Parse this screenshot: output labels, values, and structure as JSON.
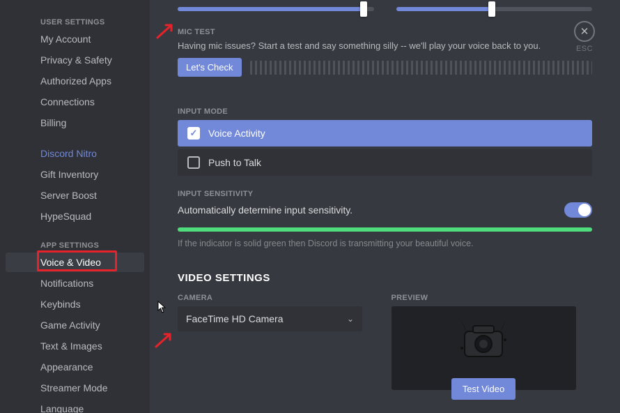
{
  "esc_label": "ESC",
  "sidebar": {
    "header1": "USER SETTINGS",
    "items1": [
      {
        "label": "My Account"
      },
      {
        "label": "Privacy & Safety"
      },
      {
        "label": "Authorized Apps"
      },
      {
        "label": "Connections"
      },
      {
        "label": "Billing"
      }
    ],
    "items2": [
      {
        "label": "Discord Nitro"
      },
      {
        "label": "Gift Inventory"
      },
      {
        "label": "Server Boost"
      },
      {
        "label": "HypeSquad"
      }
    ],
    "header2": "APP SETTINGS",
    "items3": [
      {
        "label": "Voice & Video"
      },
      {
        "label": "Notifications"
      },
      {
        "label": "Keybinds"
      },
      {
        "label": "Game Activity"
      },
      {
        "label": "Text & Images"
      },
      {
        "label": "Appearance"
      },
      {
        "label": "Streamer Mode"
      },
      {
        "label": "Language"
      }
    ]
  },
  "sliders": {
    "input_pct": 95,
    "output_pct": 49
  },
  "mic_test": {
    "header": "MIC TEST",
    "text": "Having mic issues? Start a test and say something silly -- we'll play your voice back to you.",
    "button": "Let's Check"
  },
  "input_mode": {
    "header": "INPUT MODE",
    "opt1": "Voice Activity",
    "opt2": "Push to Talk"
  },
  "sensitivity": {
    "header": "INPUT SENSITIVITY",
    "text": "Automatically determine input sensitivity.",
    "hint": "If the indicator is solid green then Discord is transmitting your beautiful voice."
  },
  "video": {
    "header": "VIDEO SETTINGS",
    "cam_label": "CAMERA",
    "cam_value": "FaceTime HD Camera",
    "preview_label": "PREVIEW",
    "test_button": "Test Video"
  }
}
